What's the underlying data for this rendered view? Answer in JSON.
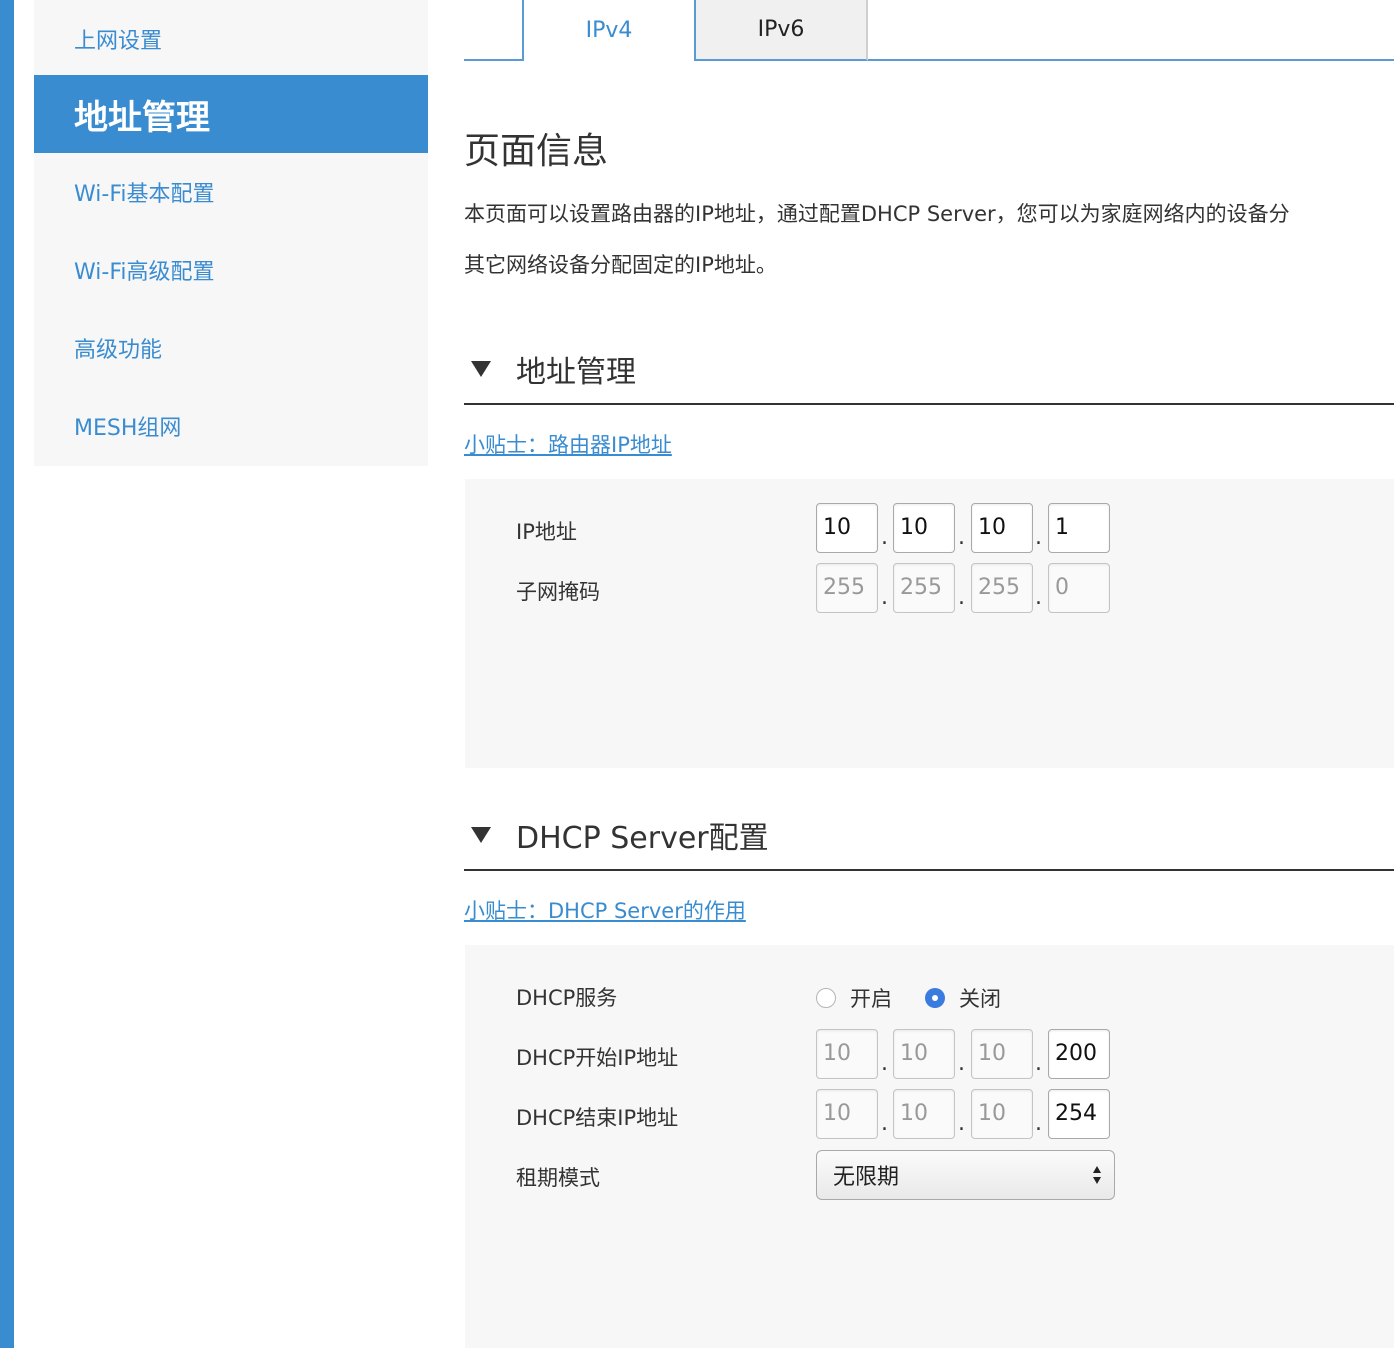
{
  "sidebar": {
    "items": [
      {
        "label": "上网设置"
      },
      {
        "label": "地址管理",
        "active": true
      },
      {
        "label": "Wi-Fi基本配置"
      },
      {
        "label": "Wi-Fi高级配置"
      },
      {
        "label": "高级功能"
      },
      {
        "label": "MESH组网"
      }
    ]
  },
  "tabs": [
    {
      "label": "IPv4",
      "active": true
    },
    {
      "label": "IPv6"
    }
  ],
  "page_info": {
    "title": "页面信息",
    "desc_line1": "本页面可以设置路由器的IP地址，通过配置DHCP Server，您可以为家庭网络内的设备分",
    "desc_line2": "其它网络设备分配固定的IP地址。"
  },
  "address_section": {
    "title": "地址管理",
    "tip": "小贴士：路由器IP地址",
    "ip_label": "IP地址",
    "ip": [
      "10",
      "10",
      "10",
      "1"
    ],
    "mask_label": "子网掩码",
    "mask": [
      "255",
      "255",
      "255",
      "0"
    ]
  },
  "dhcp_section": {
    "title": "DHCP Server配置",
    "tip": "小贴士：DHCP Server的作用",
    "service_label": "DHCP服务",
    "option_on": "开启",
    "option_off": "关闭",
    "selected": "关闭",
    "start_label": "DHCP开始IP地址",
    "start_ip": [
      "10",
      "10",
      "10",
      "200"
    ],
    "end_label": "DHCP结束IP地址",
    "end_ip": [
      "10",
      "10",
      "10",
      "254"
    ],
    "lease_label": "租期模式",
    "lease_value": "无限期"
  },
  "colors": {
    "accent": "#3a8cd1",
    "radio_selected": "#3a7be0",
    "panel_bg": "#f7f7f7"
  }
}
